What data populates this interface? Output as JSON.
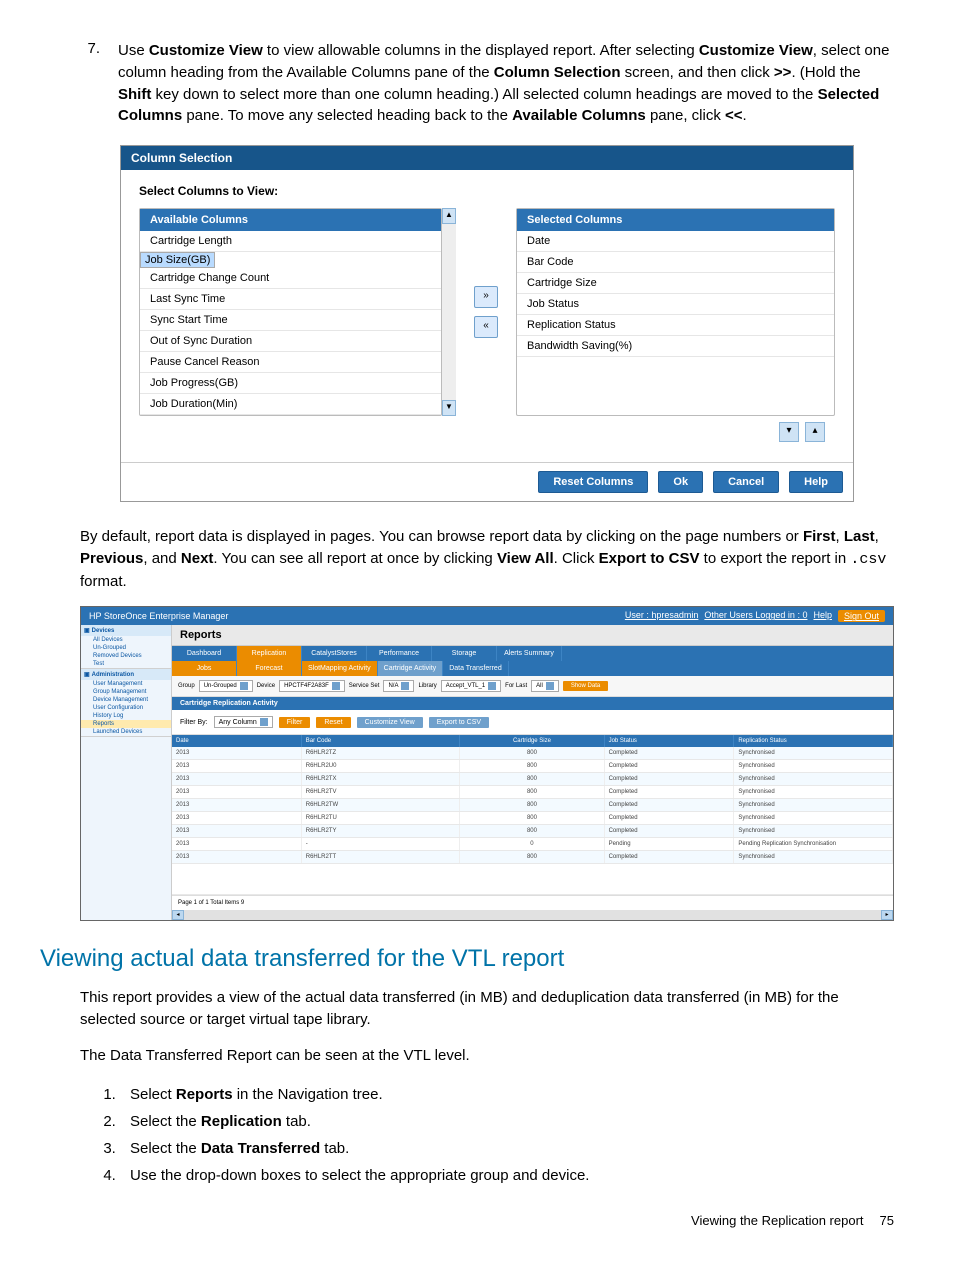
{
  "step7": {
    "num": "7.",
    "text_parts": {
      "a": "Use ",
      "b": "Customize View",
      "c": " to view allowable columns in the displayed report. After selecting ",
      "d": "Customize View",
      "e": ", select one column heading from the Available Columns pane of the ",
      "f": "Column Selection",
      "g": " screen, and then click ",
      "h": ">>",
      "i": ". (Hold the ",
      "j": "Shift",
      "k": " key down to select more than one column heading.) All selected column headings are moved to the ",
      "l": "Selected Columns",
      "m": " pane. To move any selected heading back to the ",
      "n": "Available Columns",
      "o": " pane, click ",
      "p": "<<",
      "q": "."
    }
  },
  "dialog": {
    "title": "Column Selection",
    "subtitle": "Select Columns to View:",
    "avail_head": "Available Columns",
    "sel_head": "Selected Columns",
    "available": [
      "Cartridge Length",
      "Job Size(GB)",
      "Cartridge Change Count",
      "Last Sync Time",
      "Sync Start Time",
      "Out of Sync Duration",
      "Pause Cancel Reason",
      "Job Progress(GB)",
      "Job Duration(Min)"
    ],
    "selected": [
      "Date",
      "Bar Code",
      "Cartridge Size",
      "Job Status",
      "Replication Status",
      "Bandwidth Saving(%)"
    ],
    "selected_index": 1,
    "btn_right": "»",
    "btn_left": "«",
    "reset": "Reset Columns",
    "ok": "Ok",
    "cancel": "Cancel",
    "help": "Help"
  },
  "para2": {
    "a": "By default, report data is displayed in pages. You can browse report data by clicking on the page numbers or ",
    "b": "First",
    "c": ", ",
    "d": "Last",
    "e": ", ",
    "f": "Previous",
    "g": ", and ",
    "h": "Next",
    "i": ". You can see all report at once by clicking ",
    "j": "View All",
    "k": ". Click ",
    "l": "Export to CSV",
    "m": " to export the report in ",
    "n": ".csv",
    "o": " format."
  },
  "app": {
    "title": "HP StoreOnce Enterprise Manager",
    "user_label": "User : hpresadmin",
    "other": "Other Users Logged in : 0",
    "help": "Help",
    "signout": "Sign Out",
    "sidebar": {
      "devices": "Devices",
      "dev_items": [
        "All Devices",
        "Un-Grouped",
        "Removed Devices",
        "Test"
      ],
      "admin": "Administration",
      "admin_items": [
        "User Management",
        "Group Management",
        "Device Management",
        "User Configuration",
        "History Log",
        "Reports",
        "Launched Devices"
      ],
      "reports_idx": 5
    },
    "main_title": "Reports",
    "tabs1": [
      "Dashboard",
      "Replication",
      "CatalystStores",
      "Performance",
      "Storage",
      "Alerts Summary"
    ],
    "tabs2": [
      "Jobs",
      "Forecast",
      "SlotMapping Activity",
      "Cartridge Activity",
      "Data Transferred"
    ],
    "filters": {
      "group_l": "Group",
      "group_v": "Un-Grouped",
      "device_l": "Device",
      "device_v": "HPCTF4F2A83F",
      "ss_l": "Service Set",
      "ss_v": "N/A",
      "lib_l": "Library",
      "lib_v": "Accept_VTL_1",
      "last_l": "For Last",
      "last_v": "All",
      "show": "Show Data"
    },
    "subbar": "Cartridge Replication Activity",
    "filter2": {
      "label": "Filter By:",
      "val": "Any Column",
      "filter": "Filter",
      "reset": "Reset",
      "custom": "Customize View",
      "export": "Export to CSV"
    },
    "cols": [
      "Date",
      "Bar Code",
      "Cartridge Size",
      "Job Status",
      "Replication Status"
    ],
    "rows": [
      {
        "d": "2013",
        "b": "R6HLR2TZ",
        "s": "800",
        "j": "Completed",
        "r": "Synchronised"
      },
      {
        "d": "2013",
        "b": "R6HLR2U0",
        "s": "800",
        "j": "Completed",
        "r": "Synchronised"
      },
      {
        "d": "2013",
        "b": "R6HLR2TX",
        "s": "800",
        "j": "Completed",
        "r": "Synchronised"
      },
      {
        "d": "2013",
        "b": "R6HLR2TV",
        "s": "800",
        "j": "Completed",
        "r": "Synchronised"
      },
      {
        "d": "2013",
        "b": "R6HLR2TW",
        "s": "800",
        "j": "Completed",
        "r": "Synchronised"
      },
      {
        "d": "2013",
        "b": "R6HLR2TU",
        "s": "800",
        "j": "Completed",
        "r": "Synchronised"
      },
      {
        "d": "2013",
        "b": "R6HLR2TY",
        "s": "800",
        "j": "Completed",
        "r": "Synchronised"
      },
      {
        "d": "2013",
        "b": "-",
        "s": "0",
        "j": "Pending",
        "r": "Pending Replication Synchronisation"
      },
      {
        "d": "2013",
        "b": "R6HLR2TT",
        "s": "800",
        "j": "Completed",
        "r": "Synchronised"
      }
    ],
    "footer": "Page 1 of 1   Total Items 9"
  },
  "sect": {
    "title": "Viewing actual data transferred for the VTL report",
    "p1": "This report provides a view of the actual data transferred (in MB) and deduplication data transferred (in MB) for the selected source or target virtual tape library.",
    "p2": "The Data Transferred Report can be seen at the VTL level.",
    "steps": [
      {
        "a": "Select ",
        "b": "Reports",
        "c": " in the Navigation tree."
      },
      {
        "a": "Select the ",
        "b": "Replication",
        "c": " tab."
      },
      {
        "a": "Select the ",
        "b": "Data Transferred",
        "c": " tab."
      },
      {
        "a": "Use the drop-down boxes to select the appropriate group and device.",
        "b": "",
        "c": ""
      }
    ]
  },
  "pagefoot": {
    "label": "Viewing the Replication report",
    "num": "75"
  }
}
